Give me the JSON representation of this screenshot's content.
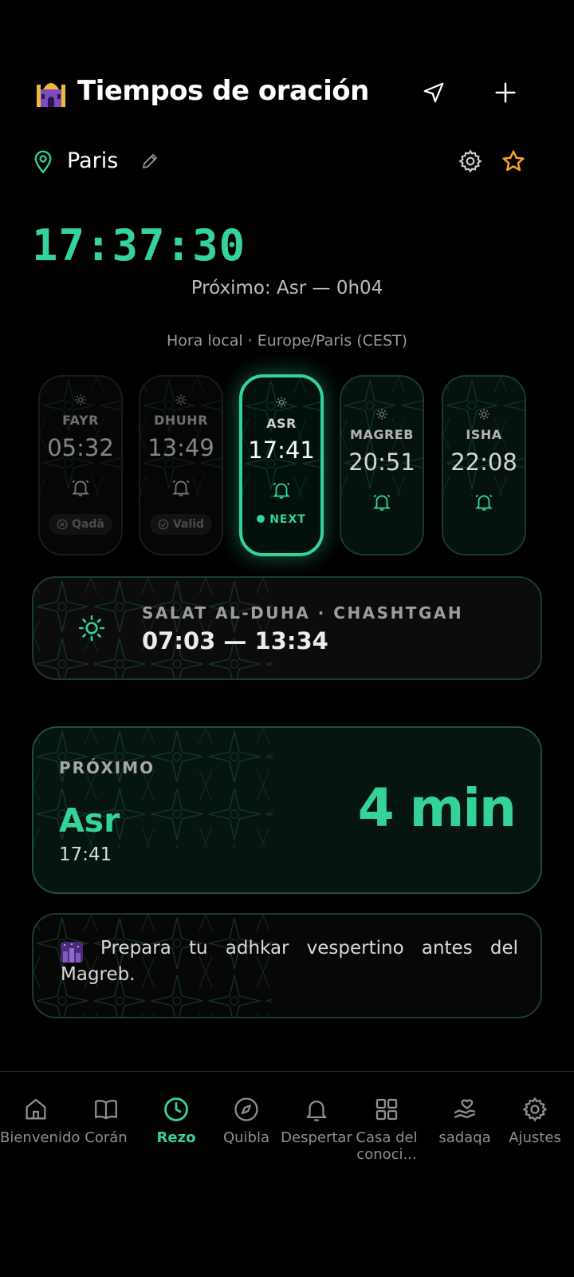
{
  "header": {
    "title": "Tiempos de oración",
    "icons": [
      "mosque-emoji",
      "navigation-arrow-icon",
      "plus-icon"
    ]
  },
  "location": {
    "city": "Paris",
    "icons": [
      "map-pin-icon",
      "pencil-icon",
      "gear-icon",
      "star-icon"
    ]
  },
  "clock": {
    "time": "17:37:30",
    "next_label": "Próximo: Asr — 0h04",
    "timezone": "Hora local · Europe/Paris (CEST)"
  },
  "prayers": [
    {
      "name": "FAYR",
      "time": "05:32",
      "status": "Qadā",
      "state": "past"
    },
    {
      "name": "DHUHR",
      "time": "13:49",
      "status": "Valid",
      "state": "past"
    },
    {
      "name": "ASR",
      "time": "17:41",
      "status": "NEXT",
      "state": "next"
    },
    {
      "name": "MAGREB",
      "time": "20:51",
      "state": "future"
    },
    {
      "name": "ISHA",
      "time": "22:08",
      "state": "future"
    }
  ],
  "duha": {
    "title": "SALAT AL-DUHA · CHASHTGAH",
    "range": "07:03 — 13:34"
  },
  "upcoming": {
    "label": "PRÓXIMO",
    "name": "Asr",
    "time": "17:41",
    "remaining": "4 min"
  },
  "tip": {
    "text": "Prepara tu adhkar vespertino antes del Magreb."
  },
  "tabs": [
    {
      "label": "Bienvenido",
      "icon": "home-icon"
    },
    {
      "label": "Corán",
      "icon": "book-icon"
    },
    {
      "label": "Rezo",
      "icon": "clock-icon",
      "active": true
    },
    {
      "label": "Quibla",
      "icon": "compass-icon"
    },
    {
      "label": "Despertar",
      "icon": "bell-icon"
    },
    {
      "label": "Casa del conoci...",
      "icon": "grid-icon"
    },
    {
      "label": "sadaqa",
      "icon": "hand-heart-icon"
    },
    {
      "label": "Ajustes",
      "icon": "gear-icon"
    }
  ],
  "colors": {
    "accent": "#34d399",
    "background": "#000000",
    "star": "#f5a524"
  }
}
